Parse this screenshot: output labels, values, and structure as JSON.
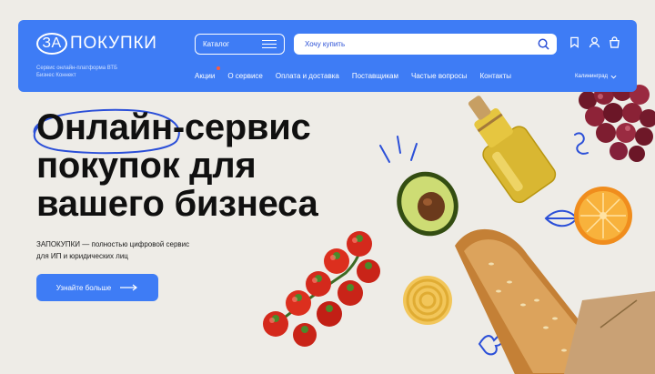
{
  "header": {
    "logo_mark": "ЗА",
    "logo_word": "ПОКУПКИ",
    "tagline": "Сервис онлайн-платформа ВТБ Бизнес Коннект",
    "catalog_label": "Каталог",
    "search_placeholder": "Хочу купить",
    "icons": [
      "bookmark-icon",
      "user-icon",
      "cart-icon",
      "search-icon"
    ],
    "city": "Калининград"
  },
  "nav": {
    "items": [
      "Акции",
      "О сервисе",
      "Оплата и доставка",
      "Поставщикам",
      "Частые вопросы",
      "Контакты"
    ]
  },
  "hero": {
    "title_lines": [
      "Онлайн-сервис",
      "покупок для",
      "вашего бизнеса"
    ],
    "description": "ЗАПОКУПКИ — полностью цифровой сервис для ИП и юридических лиц",
    "cta_label": "Узнайте больше"
  },
  "colors": {
    "accent": "#3e7cf5",
    "background": "#eeece7",
    "nav_dot": "#ff5a3c"
  }
}
